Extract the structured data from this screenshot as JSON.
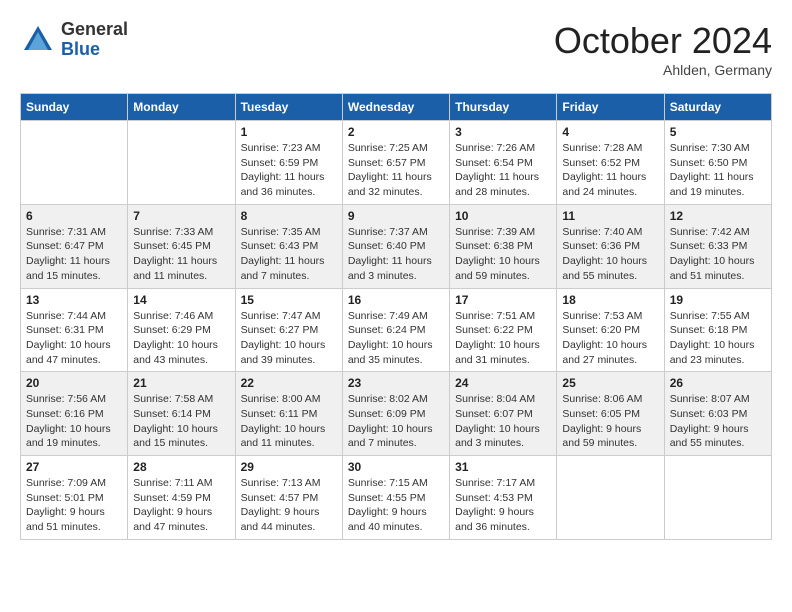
{
  "header": {
    "logo_line1": "General",
    "logo_line2": "Blue",
    "month": "October 2024",
    "location": "Ahlden, Germany"
  },
  "weekdays": [
    "Sunday",
    "Monday",
    "Tuesday",
    "Wednesday",
    "Thursday",
    "Friday",
    "Saturday"
  ],
  "weeks": [
    [
      {
        "day": "",
        "info": ""
      },
      {
        "day": "",
        "info": ""
      },
      {
        "day": "1",
        "info": "Sunrise: 7:23 AM\nSunset: 6:59 PM\nDaylight: 11 hours and 36 minutes."
      },
      {
        "day": "2",
        "info": "Sunrise: 7:25 AM\nSunset: 6:57 PM\nDaylight: 11 hours and 32 minutes."
      },
      {
        "day": "3",
        "info": "Sunrise: 7:26 AM\nSunset: 6:54 PM\nDaylight: 11 hours and 28 minutes."
      },
      {
        "day": "4",
        "info": "Sunrise: 7:28 AM\nSunset: 6:52 PM\nDaylight: 11 hours and 24 minutes."
      },
      {
        "day": "5",
        "info": "Sunrise: 7:30 AM\nSunset: 6:50 PM\nDaylight: 11 hours and 19 minutes."
      }
    ],
    [
      {
        "day": "6",
        "info": "Sunrise: 7:31 AM\nSunset: 6:47 PM\nDaylight: 11 hours and 15 minutes."
      },
      {
        "day": "7",
        "info": "Sunrise: 7:33 AM\nSunset: 6:45 PM\nDaylight: 11 hours and 11 minutes."
      },
      {
        "day": "8",
        "info": "Sunrise: 7:35 AM\nSunset: 6:43 PM\nDaylight: 11 hours and 7 minutes."
      },
      {
        "day": "9",
        "info": "Sunrise: 7:37 AM\nSunset: 6:40 PM\nDaylight: 11 hours and 3 minutes."
      },
      {
        "day": "10",
        "info": "Sunrise: 7:39 AM\nSunset: 6:38 PM\nDaylight: 10 hours and 59 minutes."
      },
      {
        "day": "11",
        "info": "Sunrise: 7:40 AM\nSunset: 6:36 PM\nDaylight: 10 hours and 55 minutes."
      },
      {
        "day": "12",
        "info": "Sunrise: 7:42 AM\nSunset: 6:33 PM\nDaylight: 10 hours and 51 minutes."
      }
    ],
    [
      {
        "day": "13",
        "info": "Sunrise: 7:44 AM\nSunset: 6:31 PM\nDaylight: 10 hours and 47 minutes."
      },
      {
        "day": "14",
        "info": "Sunrise: 7:46 AM\nSunset: 6:29 PM\nDaylight: 10 hours and 43 minutes."
      },
      {
        "day": "15",
        "info": "Sunrise: 7:47 AM\nSunset: 6:27 PM\nDaylight: 10 hours and 39 minutes."
      },
      {
        "day": "16",
        "info": "Sunrise: 7:49 AM\nSunset: 6:24 PM\nDaylight: 10 hours and 35 minutes."
      },
      {
        "day": "17",
        "info": "Sunrise: 7:51 AM\nSunset: 6:22 PM\nDaylight: 10 hours and 31 minutes."
      },
      {
        "day": "18",
        "info": "Sunrise: 7:53 AM\nSunset: 6:20 PM\nDaylight: 10 hours and 27 minutes."
      },
      {
        "day": "19",
        "info": "Sunrise: 7:55 AM\nSunset: 6:18 PM\nDaylight: 10 hours and 23 minutes."
      }
    ],
    [
      {
        "day": "20",
        "info": "Sunrise: 7:56 AM\nSunset: 6:16 PM\nDaylight: 10 hours and 19 minutes."
      },
      {
        "day": "21",
        "info": "Sunrise: 7:58 AM\nSunset: 6:14 PM\nDaylight: 10 hours and 15 minutes."
      },
      {
        "day": "22",
        "info": "Sunrise: 8:00 AM\nSunset: 6:11 PM\nDaylight: 10 hours and 11 minutes."
      },
      {
        "day": "23",
        "info": "Sunrise: 8:02 AM\nSunset: 6:09 PM\nDaylight: 10 hours and 7 minutes."
      },
      {
        "day": "24",
        "info": "Sunrise: 8:04 AM\nSunset: 6:07 PM\nDaylight: 10 hours and 3 minutes."
      },
      {
        "day": "25",
        "info": "Sunrise: 8:06 AM\nSunset: 6:05 PM\nDaylight: 9 hours and 59 minutes."
      },
      {
        "day": "26",
        "info": "Sunrise: 8:07 AM\nSunset: 6:03 PM\nDaylight: 9 hours and 55 minutes."
      }
    ],
    [
      {
        "day": "27",
        "info": "Sunrise: 7:09 AM\nSunset: 5:01 PM\nDaylight: 9 hours and 51 minutes."
      },
      {
        "day": "28",
        "info": "Sunrise: 7:11 AM\nSunset: 4:59 PM\nDaylight: 9 hours and 47 minutes."
      },
      {
        "day": "29",
        "info": "Sunrise: 7:13 AM\nSunset: 4:57 PM\nDaylight: 9 hours and 44 minutes."
      },
      {
        "day": "30",
        "info": "Sunrise: 7:15 AM\nSunset: 4:55 PM\nDaylight: 9 hours and 40 minutes."
      },
      {
        "day": "31",
        "info": "Sunrise: 7:17 AM\nSunset: 4:53 PM\nDaylight: 9 hours and 36 minutes."
      },
      {
        "day": "",
        "info": ""
      },
      {
        "day": "",
        "info": ""
      }
    ]
  ]
}
